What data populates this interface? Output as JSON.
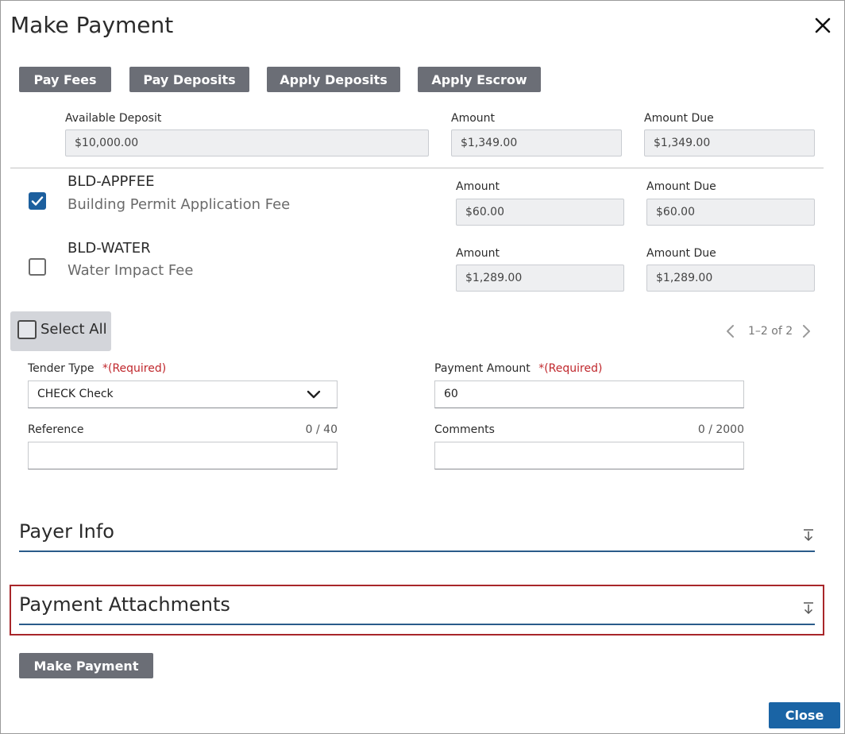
{
  "dialog": {
    "title": "Make Payment",
    "close_icon": "close-icon"
  },
  "toolbar": {
    "pay_fees": "Pay Fees",
    "pay_deposits": "Pay Deposits",
    "apply_deposits": "Apply Deposits",
    "apply_escrow": "Apply Escrow"
  },
  "deposit": {
    "available_label": "Available Deposit",
    "available_value": "$10,000.00",
    "amount_label": "Amount",
    "amount_value": "$1,349.00",
    "due_label": "Amount Due",
    "due_value": "$1,349.00"
  },
  "fees": [
    {
      "code": "BLD-APPFEE",
      "description": "Building Permit Application Fee",
      "checked": true,
      "amount_label": "Amount",
      "amount": "$60.00",
      "due_label": "Amount Due",
      "due": "$60.00"
    },
    {
      "code": "BLD-WATER",
      "description": "Water Impact Fee",
      "checked": false,
      "amount_label": "Amount",
      "amount": "$1,289.00",
      "due_label": "Amount Due",
      "due": "$1,289.00"
    }
  ],
  "select_all": {
    "label": "Select All"
  },
  "pager": {
    "text": "1–2 of 2"
  },
  "form": {
    "tender_label": "Tender Type",
    "tender_required": "*(Required)",
    "tender_value": "CHECK Check",
    "payment_label": "Payment Amount",
    "payment_required": "*(Required)",
    "payment_value": "60",
    "reference_label": "Reference",
    "reference_count": "0 / 40",
    "reference_value": "",
    "comments_label": "Comments",
    "comments_count": "0 / 2000",
    "comments_value": ""
  },
  "sections": {
    "payer_info": "Payer Info",
    "attachments": "Payment Attachments"
  },
  "actions": {
    "make_payment": "Make Payment",
    "close": "Close"
  },
  "colors": {
    "button_gray": "#6b6e76",
    "primary_blue": "#1a64a5",
    "required_red": "#c0282d",
    "highlight_red": "#a8262a"
  }
}
